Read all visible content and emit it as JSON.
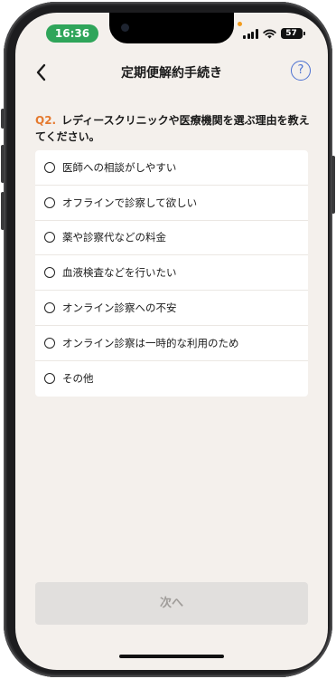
{
  "status_bar": {
    "time": "16:36",
    "battery": "57"
  },
  "header": {
    "title": "定期便解約手続き",
    "help_symbol": "?"
  },
  "question": {
    "number": "Q2.",
    "text": "レディースクリニックや医療機関を選ぶ理由を教えてください。"
  },
  "options": [
    {
      "label": "医師への相談がしやすい"
    },
    {
      "label": "オフラインで診察して欲しい"
    },
    {
      "label": "薬や診察代などの料金"
    },
    {
      "label": "血液検査などを行いたい"
    },
    {
      "label": "オンライン診察への不安"
    },
    {
      "label": "オンライン診察は一時的な利用のため"
    },
    {
      "label": "その他"
    }
  ],
  "footer": {
    "next_label": "次へ"
  },
  "colors": {
    "accent_question": "#e57a2f",
    "help_icon": "#4a6fd1",
    "time_pill": "#2fa55a",
    "screen_bg": "#f4f0ec",
    "next_disabled_bg": "#e1dfdd"
  },
  "icons": {
    "back": "chevron-left-icon",
    "help": "help-circle-icon",
    "signal": "cellular-signal-icon",
    "wifi": "wifi-icon",
    "battery": "battery-icon",
    "radio": "radio-empty-icon"
  }
}
